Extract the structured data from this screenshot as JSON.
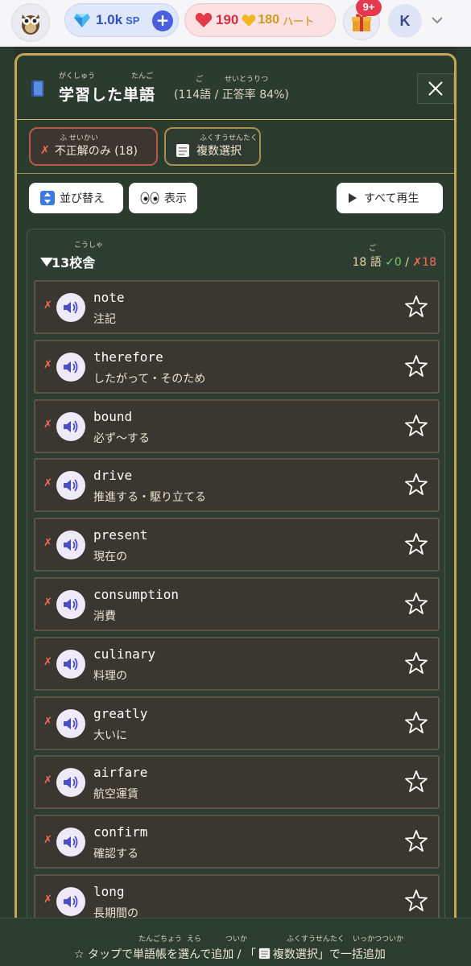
{
  "topbar": {
    "sp_value": "1.0k",
    "sp_unit": "SP",
    "hearts_red": "190",
    "hearts_gold": "180",
    "hearts_label": "ハート",
    "gift_badge": "9+",
    "avatar_letter": "K"
  },
  "modal": {
    "title": "学習した単語",
    "title_ruby_1": "がくしゅう",
    "title_ruby_2": "たんご",
    "stats": "(114語 / 正答率 84%)",
    "stats_ruby_1": "ご",
    "stats_ruby_2": "せいとうりつ",
    "filter_incorrect": "不正解のみ (18)",
    "filter_incorrect_ruby": "ふ せいかい",
    "filter_multi": "複数選択",
    "filter_multi_ruby": "ふくすうせんたく",
    "sort_label": "並び替え",
    "show_label": "表示",
    "play_all_label": "すべて再生"
  },
  "group": {
    "title": "13校舎",
    "title_ruby": "こうしゃ",
    "count_prefix": "18 語",
    "count_ruby": "ご",
    "correct": "✓0",
    "sep": "/",
    "incorrect": "✗18"
  },
  "words": [
    {
      "word": "note",
      "meaning": "注記"
    },
    {
      "word": "therefore",
      "meaning": "したがって・そのため"
    },
    {
      "word": "bound",
      "meaning": "必ず〜する"
    },
    {
      "word": "drive",
      "meaning": "推進する・駆り立てる"
    },
    {
      "word": "present",
      "meaning": "現在の"
    },
    {
      "word": "consumption",
      "meaning": "消費"
    },
    {
      "word": "culinary",
      "meaning": "料理の"
    },
    {
      "word": "greatly",
      "meaning": "大いに"
    },
    {
      "word": "airfare",
      "meaning": "航空運賃"
    },
    {
      "word": "confirm",
      "meaning": "確認する"
    },
    {
      "word": "long",
      "meaning": "長期間の"
    }
  ],
  "footer": {
    "text_1": "☆ タップで単語帳を選んで追加 / 「",
    "text_2": "複数選択」で一括追加",
    "ruby_1": "たんごちょう",
    "ruby_2": "えら",
    "ruby_3": "ついか",
    "ruby_4": "ふくすうせんたく",
    "ruby_5": "いっかつついか"
  }
}
